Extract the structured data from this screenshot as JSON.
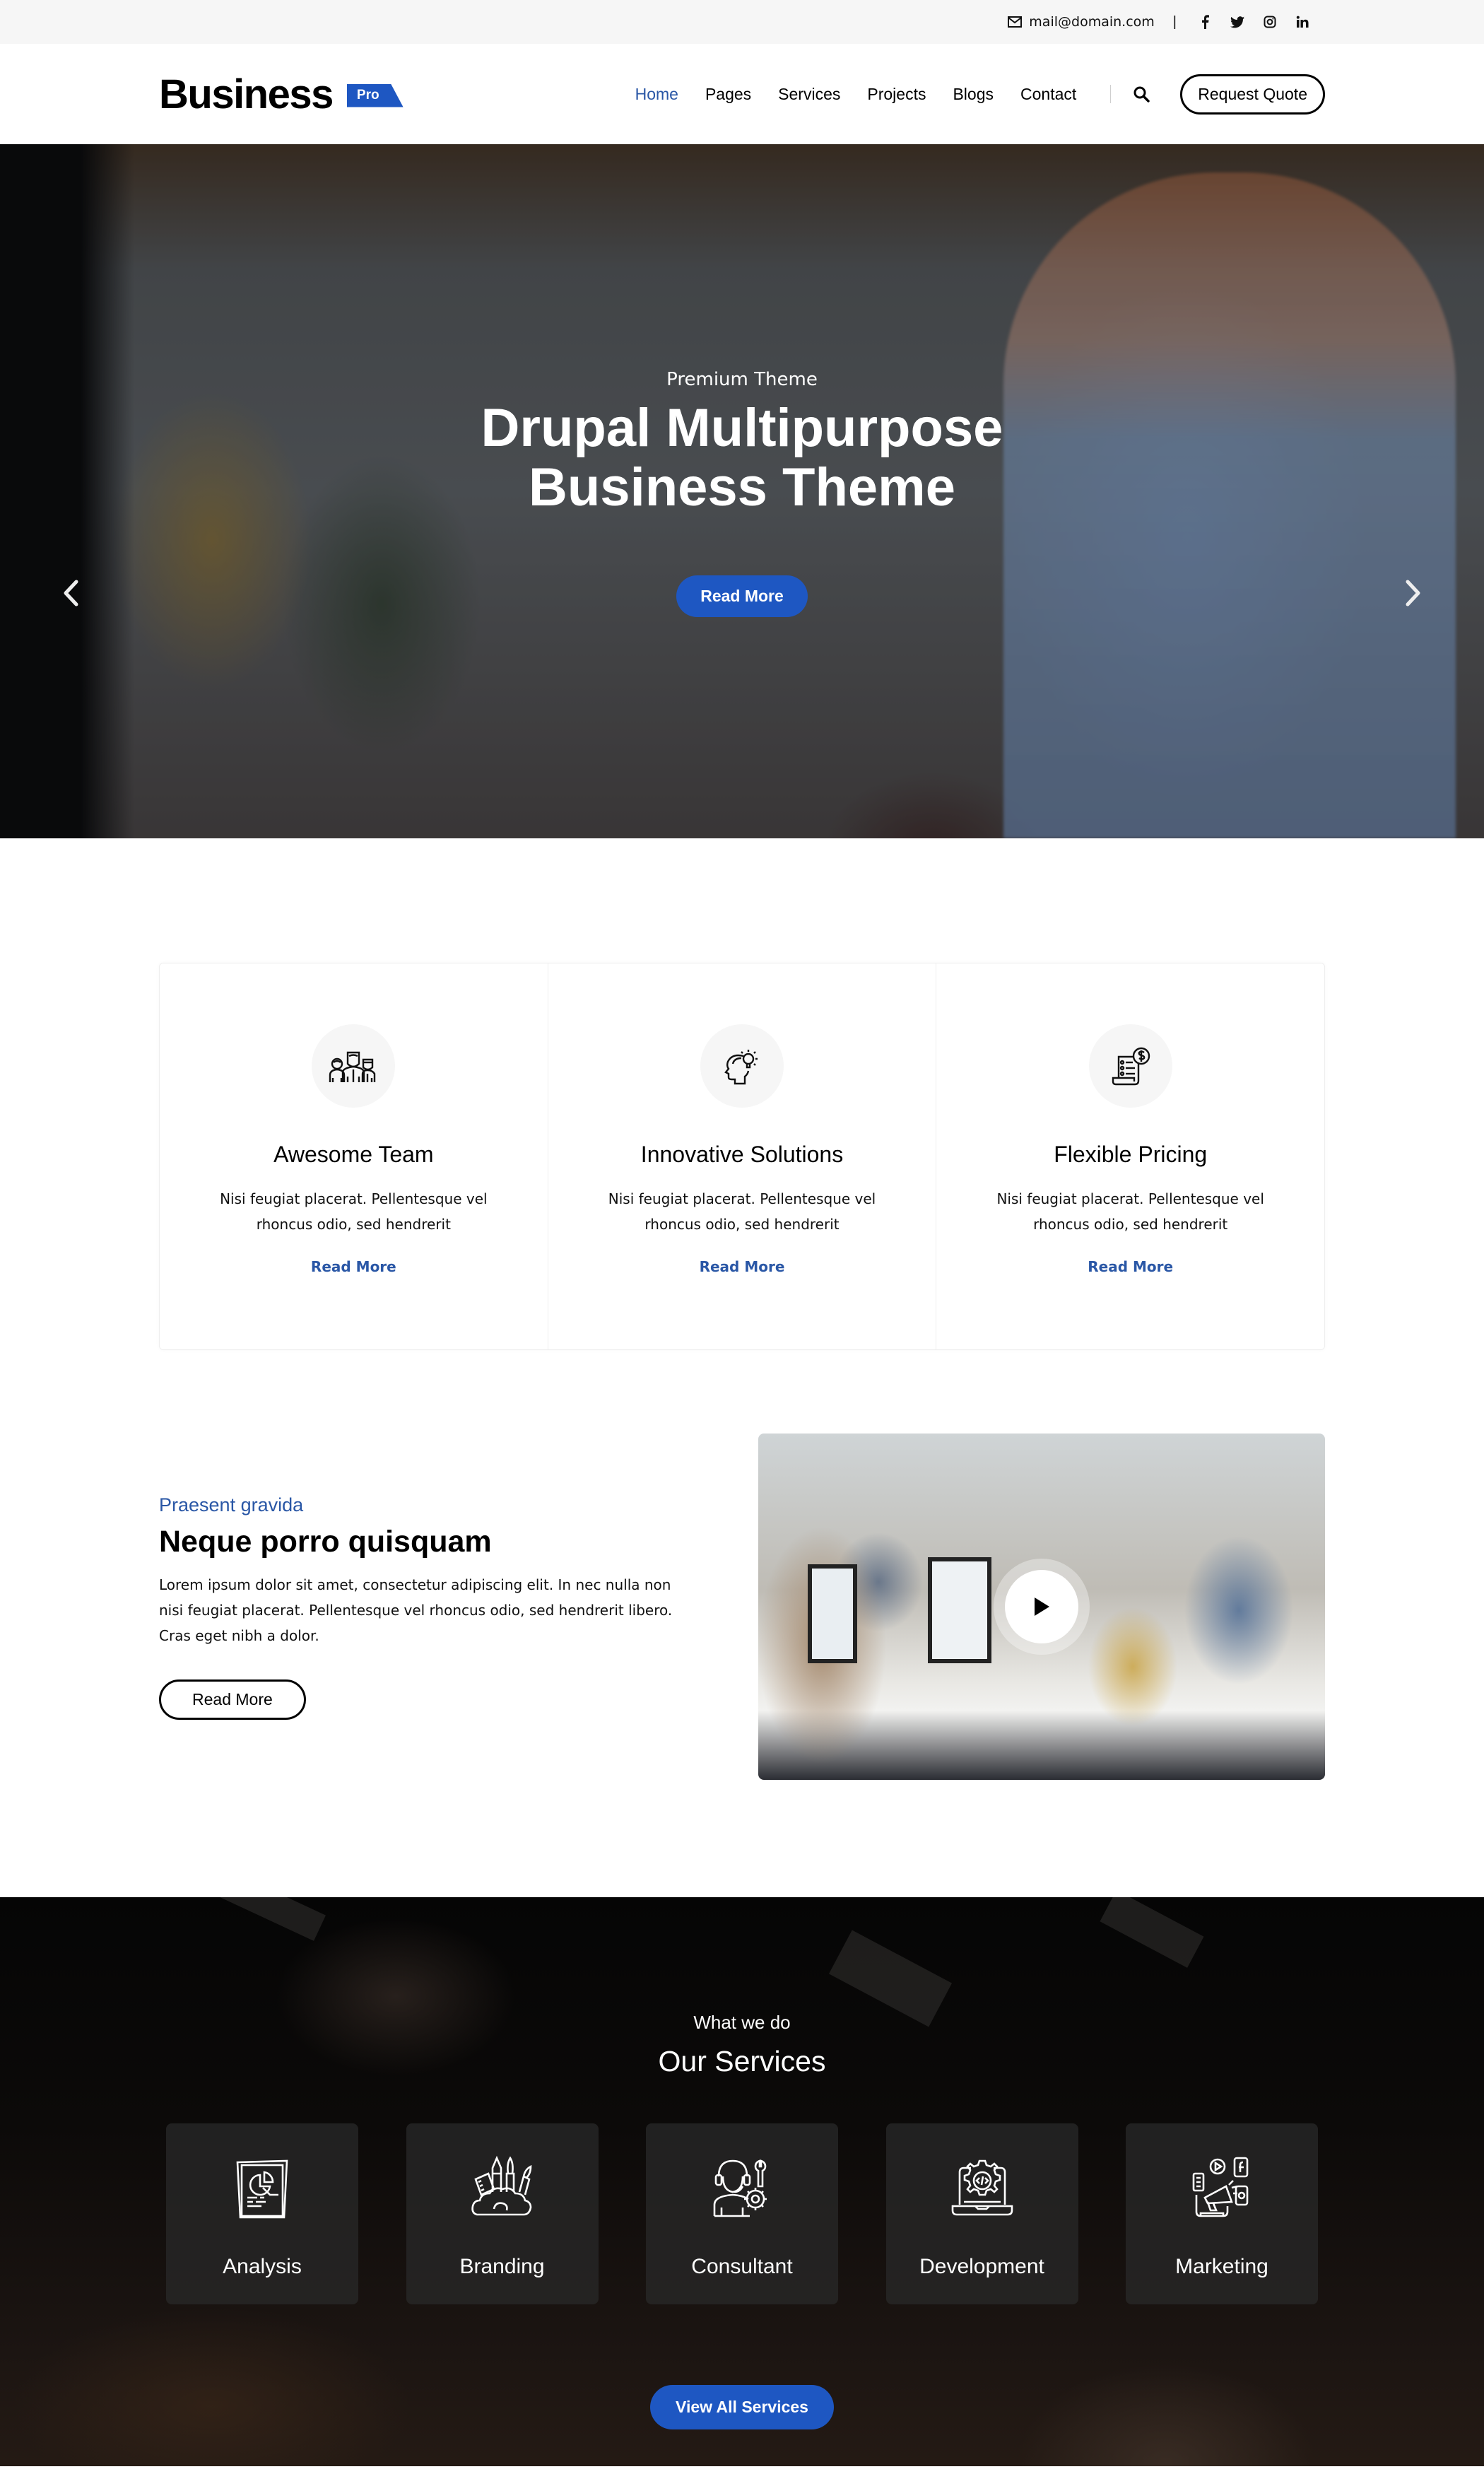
{
  "topbar": {
    "email": "mail@domain.com",
    "separator": "|",
    "socials": [
      "facebook",
      "twitter",
      "instagram",
      "linkedin"
    ]
  },
  "header": {
    "logo_text": "Business",
    "logo_badge": "Pro",
    "nav": [
      {
        "label": "Home",
        "active": true
      },
      {
        "label": "Pages",
        "active": false
      },
      {
        "label": "Services",
        "active": false
      },
      {
        "label": "Projects",
        "active": false
      },
      {
        "label": "Blogs",
        "active": false
      },
      {
        "label": "Contact",
        "active": false
      }
    ],
    "cta_label": "Request Quote"
  },
  "hero": {
    "subtitle": "Premium Theme",
    "title_line1": "Drupal Multipurpose",
    "title_line2": "Business Theme",
    "button_label": "Read More"
  },
  "features": [
    {
      "icon": "team-icon",
      "title": "Awesome Team",
      "text": "Nisi feugiat placerat. Pellentesque vel rhoncus odio, sed hendrerit",
      "link": "Read More"
    },
    {
      "icon": "idea-head-icon",
      "title": "Innovative Solutions",
      "text": "Nisi feugiat placerat. Pellentesque vel rhoncus odio, sed hendrerit",
      "link": "Read More"
    },
    {
      "icon": "invoice-dollar-icon",
      "title": "Flexible Pricing",
      "text": "Nisi feugiat placerat. Pellentesque vel rhoncus odio, sed hendrerit",
      "link": "Read More"
    }
  ],
  "about": {
    "kicker": "Praesent gravida",
    "title": "Neque porro quisquam",
    "text": "Lorem ipsum dolor sit amet, consectetur adipiscing elit. In nec nulla non nisi feugiat placerat. Pellentesque vel rhoncus odio, sed hendrerit libero. Cras eget nibh a dolor.",
    "button_label": "Read More"
  },
  "services": {
    "kicker": "What we do",
    "title": "Our Services",
    "items": [
      {
        "icon": "analysis-icon",
        "label": "Analysis"
      },
      {
        "icon": "branding-icon",
        "label": "Branding"
      },
      {
        "icon": "consultant-icon",
        "label": "Consultant"
      },
      {
        "icon": "development-icon",
        "label": "Development"
      },
      {
        "icon": "marketing-icon",
        "label": "Marketing"
      }
    ],
    "button_label": "View All Services"
  },
  "colors": {
    "accent": "#1e57c2",
    "link": "#2a57a6",
    "topbar_bg": "#f6f6f6"
  }
}
